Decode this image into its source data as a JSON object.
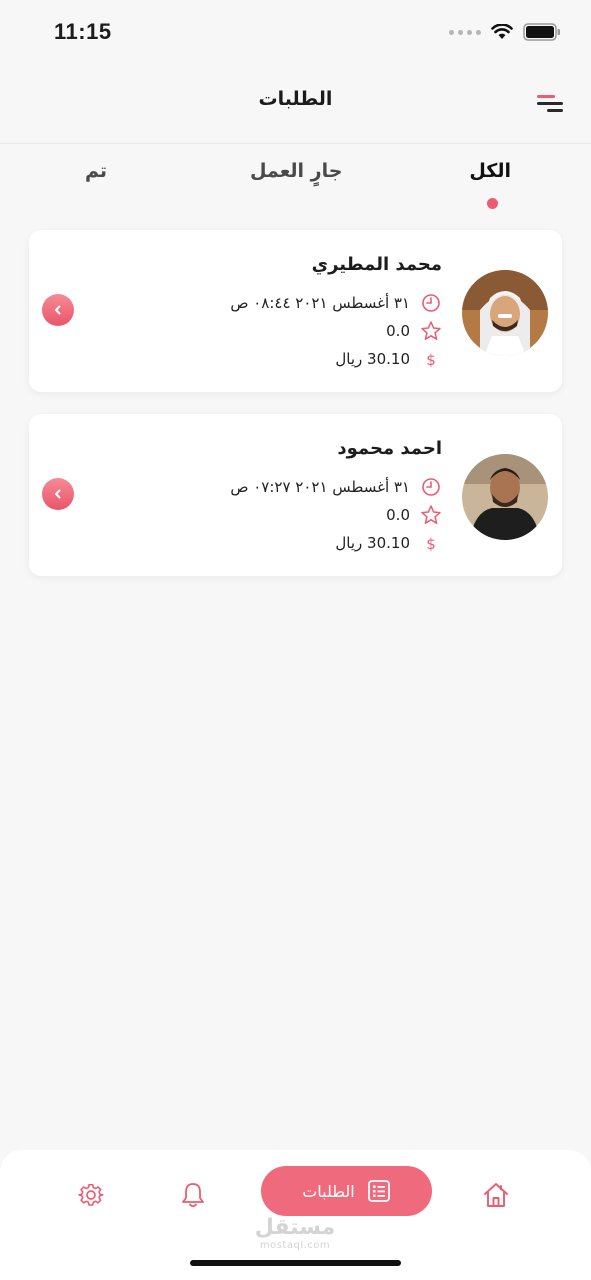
{
  "status_bar": {
    "time": "11:15"
  },
  "header": {
    "title": "الطلبات"
  },
  "tabs": [
    {
      "label": "الكل",
      "active": true
    },
    {
      "label": "جارٍ العمل",
      "active": false
    },
    {
      "label": "تم",
      "active": false
    }
  ],
  "orders": [
    {
      "customer": "محمد المطيري",
      "date": "٣١ أغسطس ٢٠٢١  ٠٨:٤٤ ص",
      "rating": "0.0",
      "price": "30.10 ريال"
    },
    {
      "customer": "احمد محمود",
      "date": "٣١ أغسطس ٢٠٢١  ٠٧:٢٧ ص",
      "rating": "0.0",
      "price": "30.10 ريال"
    }
  ],
  "bottom_nav": {
    "items": [
      {
        "icon": "home-icon"
      },
      {
        "icon": "orders-list-icon",
        "label": "الطلبات",
        "active": true
      },
      {
        "icon": "bell-icon"
      },
      {
        "icon": "gear-icon"
      }
    ]
  },
  "watermark": {
    "text": "مستقل",
    "sub": "mostaql.com"
  },
  "colors": {
    "accent": "#ec5b71",
    "background": "#f7f7f7",
    "card": "#ffffff"
  }
}
